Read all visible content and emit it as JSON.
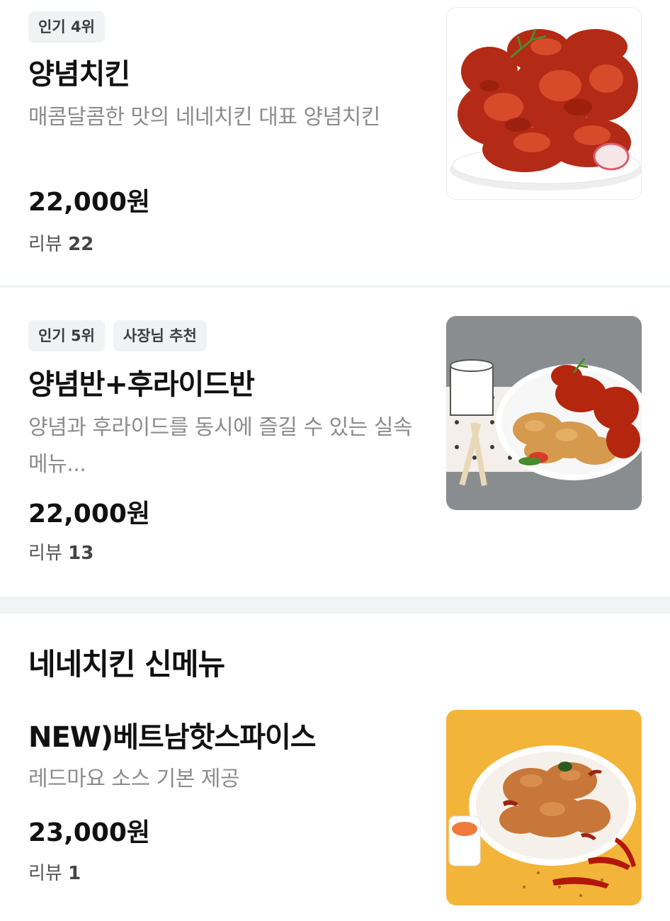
{
  "menu_items": [
    {
      "badges": [
        "인기 4위"
      ],
      "title": "양념치킨",
      "description": "매콤달콤한 맛의 네네치킨 대표 양념치킨",
      "price": "22,000원",
      "reviews_label": "리뷰",
      "reviews_count": "22"
    },
    {
      "badges": [
        "인기 5위",
        "사장님 추천"
      ],
      "title": "양념반+후라이드반",
      "description": "양념과 후라이드를 동시에 즐길 수 있는 실속메뉴...",
      "price": "22,000원",
      "reviews_label": "리뷰",
      "reviews_count": "13"
    }
  ],
  "section": {
    "title": "네네치킨 신메뉴",
    "items": [
      {
        "title": "NEW)베트남핫스파이스",
        "description": "레드마요 소스 기본 제공",
        "price": "23,000원",
        "reviews_label": "리뷰",
        "reviews_count": "1"
      }
    ]
  },
  "colors": {
    "divider": "#f1f3f4",
    "badge_bg": "#f0f2f3",
    "description": "#8c8c8c"
  }
}
